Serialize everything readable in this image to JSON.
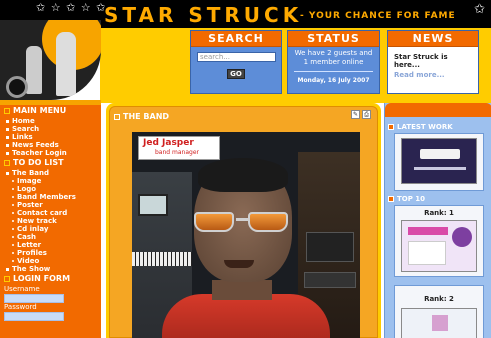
{
  "header": {
    "title": "STAR STRUCK",
    "tagline": "- YOUR CHANCE FOR FAME",
    "stars": "✩ ☆ ✩ ☆ ✩",
    "star_right": "✩"
  },
  "search": {
    "title": "SEARCH",
    "placeholder": "search...",
    "go_label": "GO"
  },
  "status": {
    "title": "STATUS",
    "text": "We have 2 guests and 1 member online",
    "date": "Monday, 16 July 2007"
  },
  "news": {
    "title": "NEWS",
    "headline": "Star Struck is here...",
    "more": "Read more..."
  },
  "sidebar": {
    "main_menu_title": "MAIN MENU",
    "main_menu": [
      "Home",
      "Search",
      "Links",
      "News Feeds",
      "Teacher Login"
    ],
    "todo_title": "TO DO LIST",
    "todo_section": "The Band",
    "todo_items": [
      "Image",
      "Logo",
      "Band Members",
      "Poster",
      "Contact card",
      "New track",
      "Cd inlay",
      "Cash",
      "Letter",
      "Profiles",
      "Video"
    ],
    "todo_footer": "The Show",
    "login_title": "LOGIN FORM",
    "username_label": "Username",
    "password_label": "Password"
  },
  "main": {
    "title": "THE BAND",
    "name_tag": {
      "name": "Jed Jasper",
      "role": "band manager"
    }
  },
  "right": {
    "latest_work_title": "LATEST WORK",
    "top10_title": "TOP 10",
    "rank1": "Rank: 1",
    "rank2": "Rank: 2"
  },
  "colors": {
    "orange": "#f26a00",
    "yellow": "#ffcc00",
    "blue": "#5d8dd8",
    "light_blue": "#9dc0ee"
  }
}
